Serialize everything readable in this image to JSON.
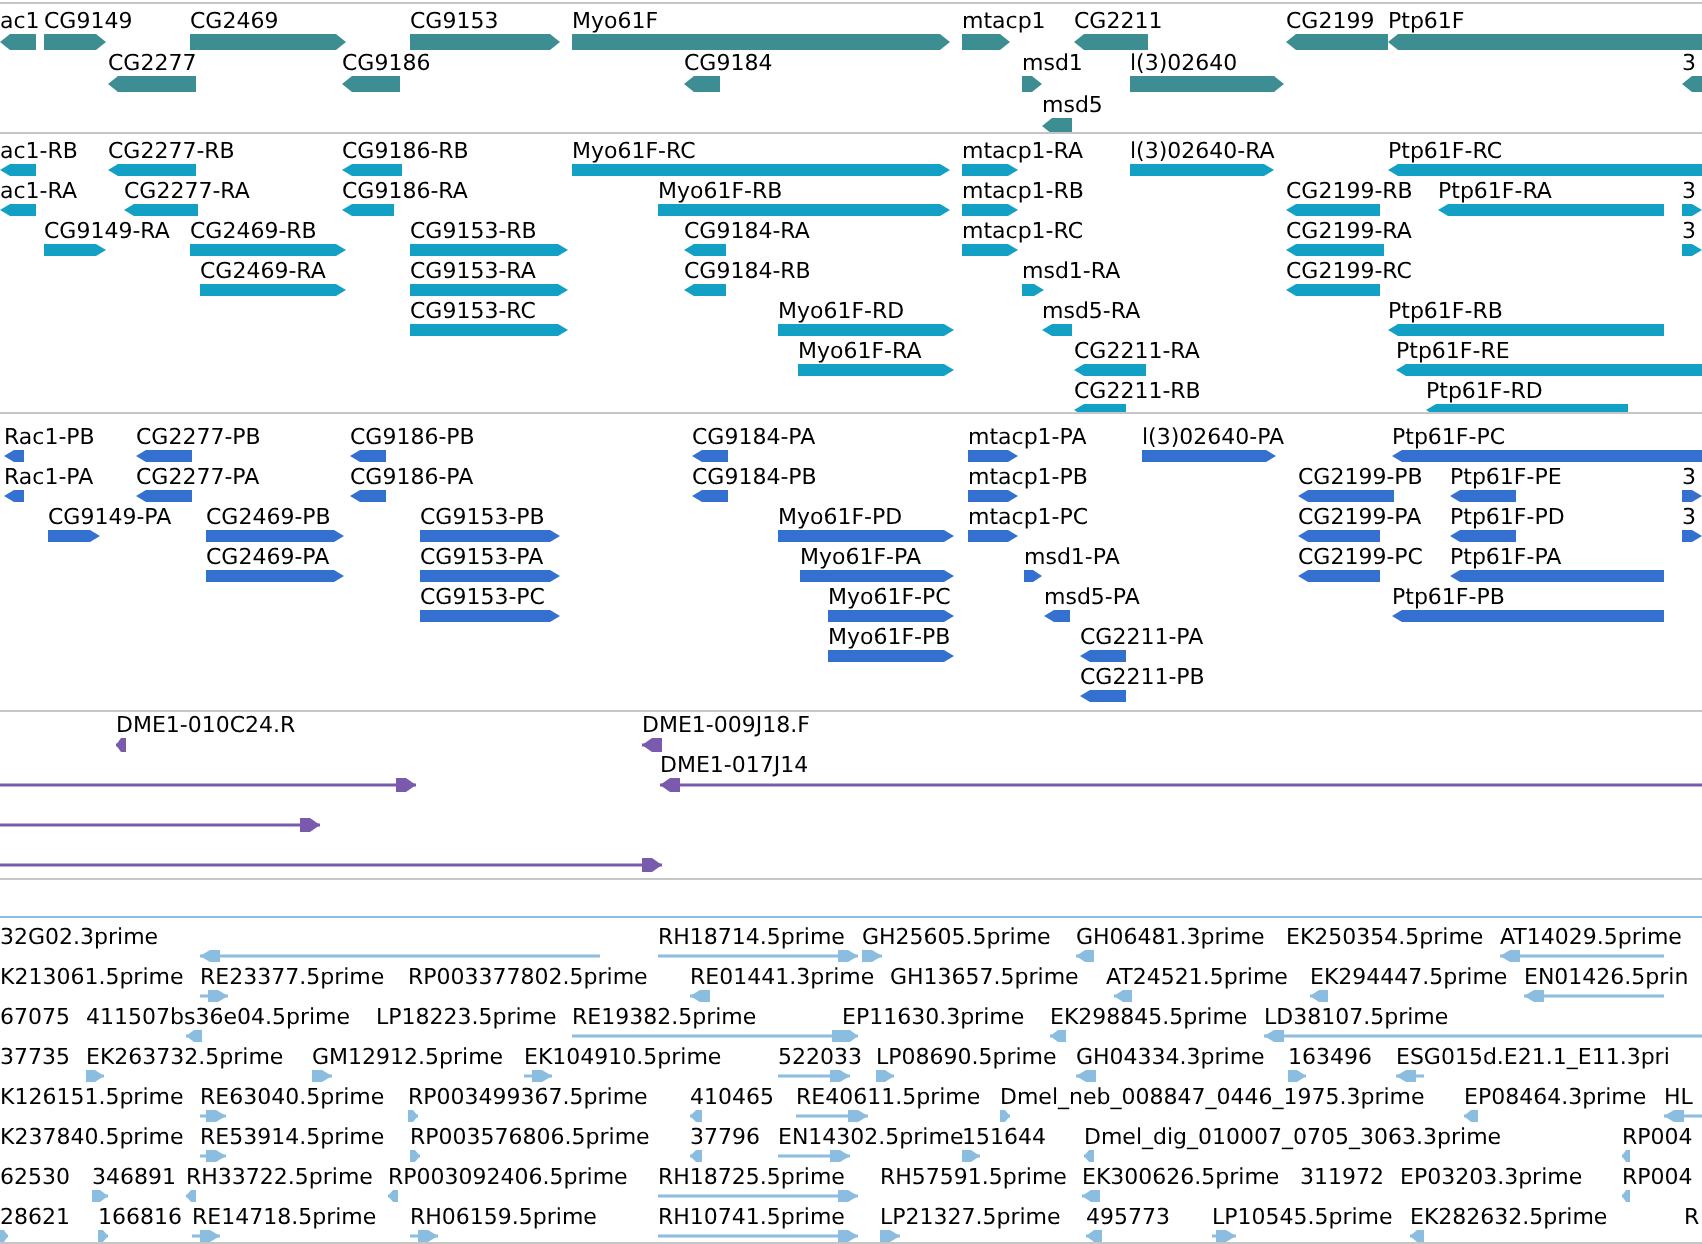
{
  "tracks": [
    {
      "kind": "gene",
      "color": "#3d8e93",
      "features": [
        {
          "label": "ac1",
          "reverse": true
        },
        {
          "label": "CG9149",
          "reverse": false
        },
        {
          "label": "CG2469",
          "reverse": false
        },
        {
          "label": "CG9153",
          "reverse": false
        },
        {
          "label": "Myo61F",
          "reverse": false
        },
        {
          "label": "mtacp1",
          "reverse": false
        },
        {
          "label": "CG2211",
          "reverse": true
        },
        {
          "label": "CG2199",
          "reverse": true
        },
        {
          "label": "Ptp61F",
          "reverse": true
        },
        {
          "label": "CG2277",
          "reverse": true
        },
        {
          "label": "CG9186",
          "reverse": true
        },
        {
          "label": "CG9184",
          "reverse": true
        },
        {
          "label": "msd1",
          "reverse": false
        },
        {
          "label": "l(3)02640",
          "reverse": false
        },
        {
          "label": "3",
          "reverse": true
        },
        {
          "label": "msd5",
          "reverse": true
        }
      ]
    },
    {
      "kind": "transcript",
      "color": "#12a0c4",
      "features": [
        {
          "label": "ac1-RB",
          "reverse": true
        },
        {
          "label": "CG2277-RB",
          "reverse": true
        },
        {
          "label": "CG9186-RB",
          "reverse": true
        },
        {
          "label": "Myo61F-RC",
          "reverse": false
        },
        {
          "label": "mtacp1-RA",
          "reverse": false
        },
        {
          "label": "l(3)02640-RA",
          "reverse": false
        },
        {
          "label": "Ptp61F-RC",
          "reverse": true
        },
        {
          "label": "ac1-RA",
          "reverse": true
        },
        {
          "label": "CG2277-RA",
          "reverse": true
        },
        {
          "label": "CG9186-RA",
          "reverse": true
        },
        {
          "label": "Myo61F-RB",
          "reverse": false
        },
        {
          "label": "mtacp1-RB",
          "reverse": false
        },
        {
          "label": "CG2199-RB",
          "reverse": true
        },
        {
          "label": "Ptp61F-RA",
          "reverse": true
        },
        {
          "label": "3",
          "reverse": false
        },
        {
          "label": "CG9149-RA",
          "reverse": false
        },
        {
          "label": "CG2469-RB",
          "reverse": false
        },
        {
          "label": "CG9153-RB",
          "reverse": false
        },
        {
          "label": "CG9184-RA",
          "reverse": true
        },
        {
          "label": "mtacp1-RC",
          "reverse": false
        },
        {
          "label": "CG2199-RA",
          "reverse": true
        },
        {
          "label": "3",
          "reverse": false
        },
        {
          "label": "CG2469-RA",
          "reverse": false
        },
        {
          "label": "CG9153-RA",
          "reverse": false
        },
        {
          "label": "CG9184-RB",
          "reverse": true
        },
        {
          "label": "msd1-RA",
          "reverse": false
        },
        {
          "label": "CG2199-RC",
          "reverse": true
        },
        {
          "label": "CG9153-RC",
          "reverse": false
        },
        {
          "label": "Myo61F-RD",
          "reverse": false
        },
        {
          "label": "msd5-RA",
          "reverse": true
        },
        {
          "label": "Ptp61F-RB",
          "reverse": true
        },
        {
          "label": "Myo61F-RA",
          "reverse": false
        },
        {
          "label": "CG2211-RA",
          "reverse": true
        },
        {
          "label": "Ptp61F-RE",
          "reverse": true
        },
        {
          "label": "CG2211-RB",
          "reverse": true
        },
        {
          "label": "Ptp61F-RD",
          "reverse": true
        }
      ]
    },
    {
      "kind": "protein",
      "color": "#3370d0",
      "features": [
        {
          "label": "Rac1-PB",
          "reverse": true
        },
        {
          "label": "CG2277-PB",
          "reverse": true
        },
        {
          "label": "CG9186-PB",
          "reverse": true
        },
        {
          "label": "CG9184-PA",
          "reverse": true
        },
        {
          "label": "mtacp1-PA",
          "reverse": false
        },
        {
          "label": "l(3)02640-PA",
          "reverse": false
        },
        {
          "label": "Ptp61F-PC",
          "reverse": true
        },
        {
          "label": "Rac1-PA",
          "reverse": true
        },
        {
          "label": "CG2277-PA",
          "reverse": true
        },
        {
          "label": "CG9186-PA",
          "reverse": true
        },
        {
          "label": "CG9184-PB",
          "reverse": true
        },
        {
          "label": "mtacp1-PB",
          "reverse": false
        },
        {
          "label": "CG2199-PB",
          "reverse": true
        },
        {
          "label": "Ptp61F-PE",
          "reverse": true
        },
        {
          "label": "3",
          "reverse": false
        },
        {
          "label": "CG9149-PA",
          "reverse": false
        },
        {
          "label": "CG2469-PB",
          "reverse": false
        },
        {
          "label": "CG9153-PB",
          "reverse": false
        },
        {
          "label": "Myo61F-PD",
          "reverse": false
        },
        {
          "label": "mtacp1-PC",
          "reverse": false
        },
        {
          "label": "CG2199-PA",
          "reverse": true
        },
        {
          "label": "Ptp61F-PD",
          "reverse": true
        },
        {
          "label": "3",
          "reverse": false
        },
        {
          "label": "CG2469-PA",
          "reverse": false
        },
        {
          "label": "CG9153-PA",
          "reverse": false
        },
        {
          "label": "Myo61F-PA",
          "reverse": false
        },
        {
          "label": "msd1-PA",
          "reverse": false
        },
        {
          "label": "CG2199-PC",
          "reverse": true
        },
        {
          "label": "Ptp61F-PA",
          "reverse": true
        },
        {
          "label": "CG9153-PC",
          "reverse": false
        },
        {
          "label": "Myo61F-PC",
          "reverse": false
        },
        {
          "label": "msd5-PA",
          "reverse": true
        },
        {
          "label": "Ptp61F-PB",
          "reverse": true
        },
        {
          "label": "Myo61F-PB",
          "reverse": false
        },
        {
          "label": "CG2211-PA",
          "reverse": true
        },
        {
          "label": "CG2211-PB",
          "reverse": true
        }
      ]
    },
    {
      "kind": "clone",
      "color": "#7a5aad",
      "features": [
        {
          "label": "DME1-010C24.R",
          "reverse": true
        },
        {
          "label": "DME1-009J18.F",
          "reverse": true
        },
        {
          "reverse": false
        },
        {
          "label": "DME1-017J14",
          "reverse": true
        },
        {
          "reverse": false
        },
        {
          "reverse": false
        }
      ]
    },
    {
      "kind": "est",
      "color": "#8bbde0",
      "features": [
        {
          "label": "32G02.3prime",
          "reverse": true
        },
        {
          "label": "RH18714.5prime",
          "reverse": false
        },
        {
          "label": "GH25605.5prime",
          "reverse": false
        },
        {
          "label": "GH06481.3prime",
          "reverse": true
        },
        {
          "label": "EK250354.5prime"
        },
        {
          "label": "AT14029.5prime",
          "reverse": true
        },
        {
          "label": "K213061.5prime"
        },
        {
          "label": "RE23377.5prime",
          "reverse": false
        },
        {
          "label": "RP003377802.5prime"
        },
        {
          "label": "RE01441.3prime",
          "reverse": true
        },
        {
          "label": "GH13657.5prime"
        },
        {
          "label": "AT24521.5prime",
          "reverse": true
        },
        {
          "label": "EK294447.5prime",
          "reverse": true
        },
        {
          "label": "EN01426.5prin",
          "reverse": true
        },
        {
          "label": "67075"
        },
        {
          "label": "411507bs36e04.5prime",
          "reverse": true
        },
        {
          "label": "LP18223.5prime"
        },
        {
          "label": "RE19382.5prime",
          "reverse": false
        },
        {
          "label": "EP11630.3prime",
          "reverse": false
        },
        {
          "label": "EK298845.5prime",
          "reverse": true
        },
        {
          "label": "LD38107.5prime",
          "reverse": true
        },
        {
          "label": "37735"
        },
        {
          "label": "EK263732.5prime",
          "reverse": false
        },
        {
          "label": "GM12912.5prime",
          "reverse": false
        },
        {
          "label": "EK104910.5prime",
          "reverse": false
        },
        {
          "label": "522033",
          "reverse": false
        },
        {
          "label": "LP08690.5prime",
          "reverse": false
        },
        {
          "label": "GH04334.3prime",
          "reverse": true
        },
        {
          "label": "163496",
          "reverse": false
        },
        {
          "label": "ESG015d.E21.1_E11.3pri",
          "reverse": true
        },
        {
          "label": "K126151.5prime"
        },
        {
          "label": "RE63040.5prime",
          "reverse": false
        },
        {
          "label": "RP003499367.5prime",
          "reverse": false
        },
        {
          "label": "410465",
          "reverse": true
        },
        {
          "label": "RE40611.5prime",
          "reverse": false
        },
        {
          "label": "Dmel_neb_008847_0446_1975.3prime",
          "reverse": false
        },
        {
          "label": "EP08464.3prime",
          "reverse": true
        },
        {
          "label": "HL",
          "reverse": true
        },
        {
          "label": "K237840.5prime"
        },
        {
          "label": "RE53914.5prime",
          "reverse": false
        },
        {
          "label": "RP003576806.5prime",
          "reverse": false
        },
        {
          "label": "37796",
          "reverse": true
        },
        {
          "label": "EN14302.5prime",
          "reverse": false
        },
        {
          "label": "151644",
          "reverse": false
        },
        {
          "label": "Dmel_dig_010007_0705_3063.3prime",
          "reverse": true
        },
        {
          "label": "RP004",
          "reverse": true
        },
        {
          "label": "62530"
        },
        {
          "label": "346891",
          "reverse": false
        },
        {
          "label": "RH33722.5prime",
          "reverse": true
        },
        {
          "label": "RP003092406.5prime",
          "reverse": true
        },
        {
          "label": "RH18725.5prime",
          "reverse": false
        },
        {
          "label": "RH57591.5prime"
        },
        {
          "label": "EK300626.5prime",
          "reverse": true
        },
        {
          "label": "311972"
        },
        {
          "label": "EP03203.3prime"
        },
        {
          "label": "RP004",
          "reverse": true
        },
        {
          "label": "28621",
          "reverse": false
        },
        {
          "label": "166816",
          "reverse": false
        },
        {
          "label": "RE14718.5prime",
          "reverse": false
        },
        {
          "label": "RH06159.5prime",
          "reverse": false
        },
        {
          "label": "RH10741.5prime",
          "reverse": false
        },
        {
          "label": "LP21327.5prime",
          "reverse": false
        },
        {
          "label": "495773",
          "reverse": true
        },
        {
          "label": "LP10545.5prime",
          "reverse": false
        },
        {
          "label": "EK282632.5prime",
          "reverse": true
        },
        {
          "label": "R"
        }
      ]
    }
  ]
}
